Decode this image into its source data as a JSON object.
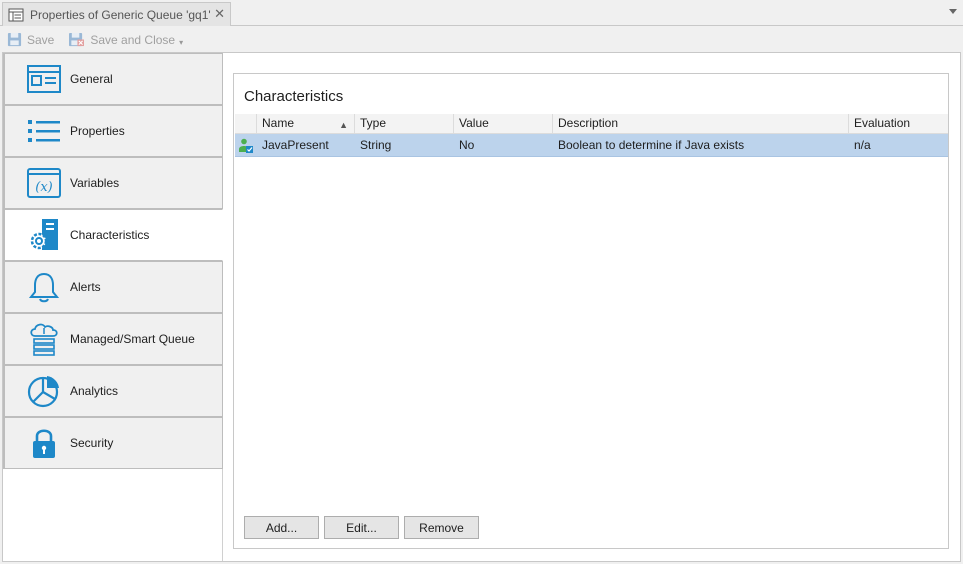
{
  "tab": {
    "title": "Properties of Generic Queue 'gq1'"
  },
  "toolbar": {
    "save_label": "Save",
    "save_close_label": "Save and Close"
  },
  "sidebar": {
    "items": [
      {
        "label": "General",
        "icon": "general-icon"
      },
      {
        "label": "Properties",
        "icon": "list-icon"
      },
      {
        "label": "Variables",
        "icon": "variable-icon"
      },
      {
        "label": "Characteristics",
        "icon": "characteristics-icon"
      },
      {
        "label": "Alerts",
        "icon": "bell-icon"
      },
      {
        "label": "Managed/Smart Queue",
        "icon": "cloud-server-icon"
      },
      {
        "label": "Analytics",
        "icon": "pie-chart-icon"
      },
      {
        "label": "Security",
        "icon": "lock-icon"
      }
    ],
    "active_index": 3
  },
  "content": {
    "title": "Characteristics",
    "columns": [
      "Name",
      "Type",
      "Value",
      "Description",
      "Evaluation"
    ],
    "sort_column": "Name",
    "sort_direction": "ascending",
    "rows": [
      {
        "name": "JavaPresent",
        "type": "String",
        "value": "No",
        "description": "Boolean to determine if Java exists",
        "evaluation": "n/a",
        "selected": true
      }
    ],
    "buttons": {
      "add": "Add...",
      "edit": "Edit...",
      "remove": "Remove"
    }
  },
  "colors": {
    "accent": "#1e88c8",
    "selection": "#bcd3ec"
  }
}
